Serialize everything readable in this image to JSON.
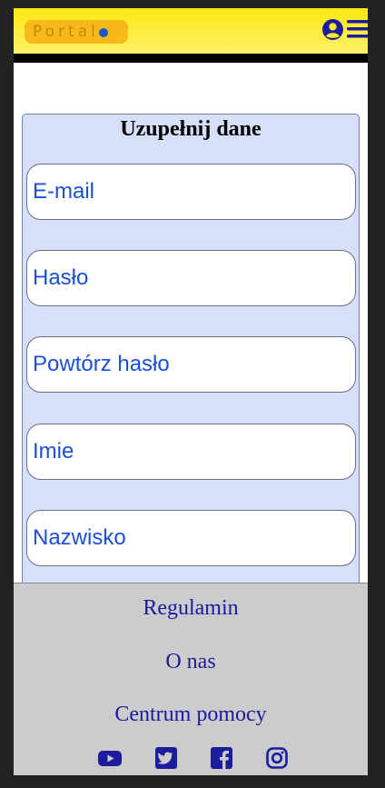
{
  "header": {
    "logo_text": "Portal",
    "colors": {
      "gradient_top": "#fde910",
      "gradient_bottom": "#fdf06a",
      "logo_bg": "#f7b81c",
      "icon": "#1c1c9e"
    },
    "icons": [
      "user-circle-icon",
      "hamburger-menu-icon"
    ]
  },
  "form": {
    "title": "Uzupełnij dane",
    "fields": [
      {
        "placeholder": "E-mail",
        "value": ""
      },
      {
        "placeholder": "Hasło",
        "value": ""
      },
      {
        "placeholder": "Powtórz hasło",
        "value": ""
      },
      {
        "placeholder": "Imie",
        "value": ""
      },
      {
        "placeholder": "Nazwisko",
        "value": ""
      }
    ],
    "colors": {
      "panel_bg": "#d7e0fb",
      "placeholder": "#1a4fd6"
    }
  },
  "footer": {
    "links": [
      {
        "label": "Regulamin"
      },
      {
        "label": "O nas"
      },
      {
        "label": "Centrum pomocy"
      }
    ],
    "social": [
      "youtube-icon",
      "twitter-icon",
      "facebook-icon",
      "instagram-icon"
    ],
    "colors": {
      "bg": "#cccccc",
      "link": "#1a1a9e"
    }
  }
}
